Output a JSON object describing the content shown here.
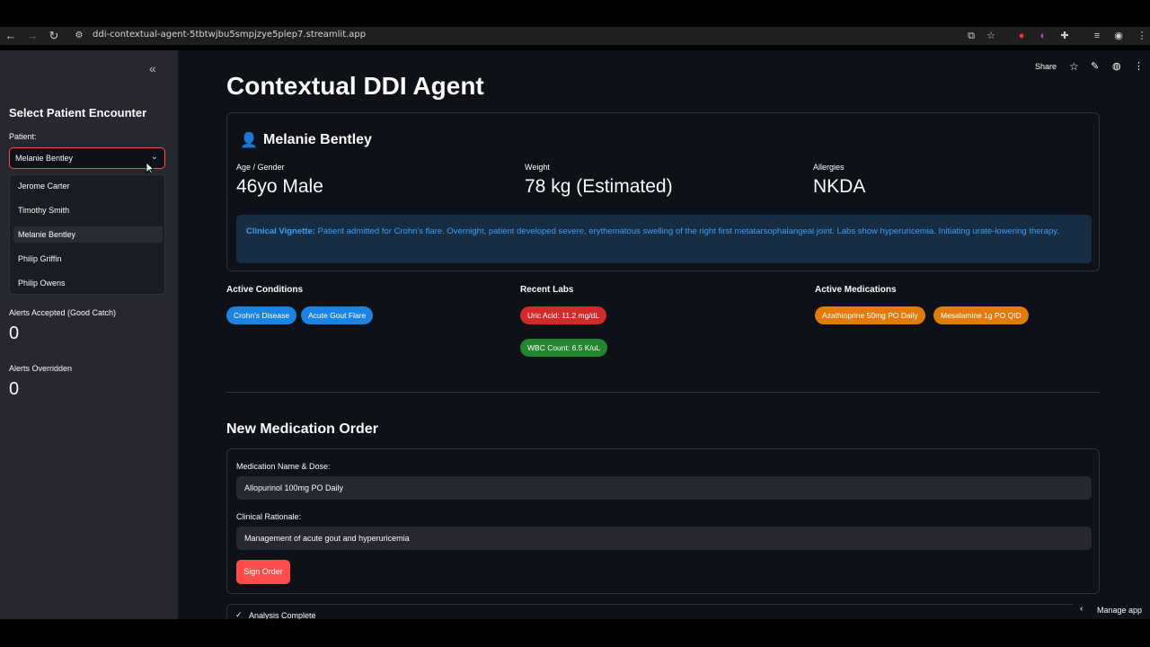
{
  "browser": {
    "url": "ddi-contextual-agent-5tbtwjbu5smpjzye5plep7.streamlit.app"
  },
  "sidebar": {
    "title": "Select Patient Encounter",
    "patient_label": "Patient:",
    "patient_value": "Melanie Bentley",
    "options": [
      "Jerome Carter",
      "Timothy Smith",
      "Melanie Bentley",
      "Philip Griffin",
      "Philip Owens"
    ],
    "selected_index": 2,
    "metrics": [
      {
        "label": "Alerts Accepted (Good Catch)",
        "value": "0"
      },
      {
        "label": "Alerts Overridden",
        "value": "0"
      }
    ]
  },
  "toolbar": {
    "share_label": "Share"
  },
  "page": {
    "title": "Contextual DDI Agent"
  },
  "patient": {
    "name": "Melanie Bentley",
    "fields": [
      {
        "label": "Age / Gender",
        "value": "46yo Male"
      },
      {
        "label": "Weight",
        "value": "78 kg (Estimated)"
      },
      {
        "label": "Allergies",
        "value": "NKDA"
      }
    ],
    "vignette_label": "Clinical Vignette:",
    "vignette_text": " Patient admitted for Crohn's flare. Overnight, patient developed severe, erythematous swelling of the right first metatarsophalangeal joint. Labs show hyperuricemia. Initiating urate-lowering therapy."
  },
  "sections": {
    "conditions": {
      "title": "Active Conditions",
      "items": [
        "Crohn's Disease",
        "Acute Gout Flare"
      ]
    },
    "labs": {
      "title": "Recent Labs",
      "items": [
        "Uric Acid: 11.2 mg/dL",
        "WBC Count: 6.5 K/uL"
      ]
    },
    "medications": {
      "title": "Active Medications",
      "items": [
        "Azathioprine 50mg PO Daily",
        "Mesalamine 1g PO QID"
      ]
    }
  },
  "order": {
    "title": "New Medication Order",
    "med_label": "Medication Name & Dose:",
    "med_value": "Allopurinol 100mg PO Daily",
    "rationale_label": "Clinical Rationale:",
    "rationale_value": "Management of acute gout and hyperuricemia",
    "sign_label": "Sign Order"
  },
  "analysis": {
    "status": "Analysis Complete"
  },
  "manage": {
    "label": "Manage app"
  },
  "colors": {
    "primary": "#ff4b4b",
    "info_text": "#3d9df3",
    "condition_pill": "#1c83e1",
    "lab_abnormal_pill": "#ce2b2b",
    "lab_normal_pill": "#21862e",
    "med_pill": "#e07b0e"
  }
}
